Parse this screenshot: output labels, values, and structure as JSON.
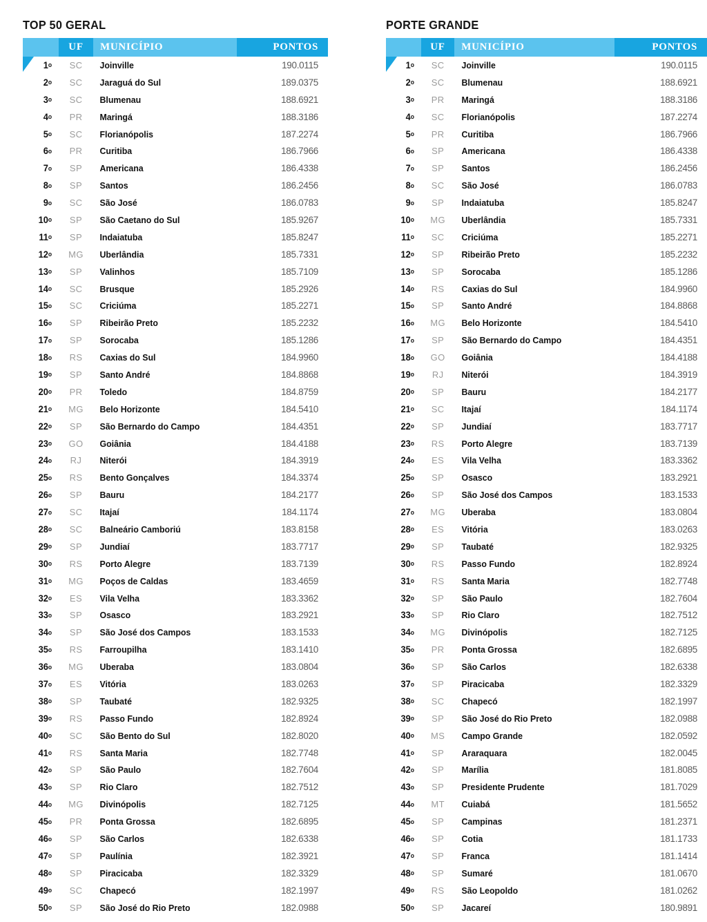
{
  "colors": {
    "header_light_blue": "#5bc3ee",
    "header_blue": "#18a5e0",
    "rank_text": "#111111",
    "uf_text": "#9b9b9b",
    "municipio_text": "#111111",
    "pontos_text": "#5a5a5a"
  },
  "columns": {
    "rank": "",
    "uf": "UF",
    "municipio": "MUNICÍPIO",
    "pontos": "PONTOS"
  },
  "tables": [
    {
      "title": "TOP 50 GERAL",
      "rows": [
        {
          "rank": "1",
          "uf": "SC",
          "municipio": "Joinville",
          "pontos": "190.0115"
        },
        {
          "rank": "2",
          "uf": "SC",
          "municipio": "Jaraguá do Sul",
          "pontos": "189.0375"
        },
        {
          "rank": "3",
          "uf": "SC",
          "municipio": "Blumenau",
          "pontos": "188.6921"
        },
        {
          "rank": "4",
          "uf": "PR",
          "municipio": "Maringá",
          "pontos": "188.3186"
        },
        {
          "rank": "5",
          "uf": "SC",
          "municipio": "Florianópolis",
          "pontos": "187.2274"
        },
        {
          "rank": "6",
          "uf": "PR",
          "municipio": "Curitiba",
          "pontos": "186.7966"
        },
        {
          "rank": "7",
          "uf": "SP",
          "municipio": "Americana",
          "pontos": "186.4338"
        },
        {
          "rank": "8",
          "uf": "SP",
          "municipio": "Santos",
          "pontos": "186.2456"
        },
        {
          "rank": "9",
          "uf": "SC",
          "municipio": "São José",
          "pontos": "186.0783"
        },
        {
          "rank": "10",
          "uf": "SP",
          "municipio": "São Caetano do Sul",
          "pontos": "185.9267"
        },
        {
          "rank": "11",
          "uf": "SP",
          "municipio": "Indaiatuba",
          "pontos": "185.8247"
        },
        {
          "rank": "12",
          "uf": "MG",
          "municipio": "Uberlândia",
          "pontos": "185.7331"
        },
        {
          "rank": "13",
          "uf": "SP",
          "municipio": "Valinhos",
          "pontos": "185.7109"
        },
        {
          "rank": "14",
          "uf": "SC",
          "municipio": "Brusque",
          "pontos": "185.2926"
        },
        {
          "rank": "15",
          "uf": "SC",
          "municipio": "Criciúma",
          "pontos": "185.2271"
        },
        {
          "rank": "16",
          "uf": "SP",
          "municipio": "Ribeirão Preto",
          "pontos": "185.2232"
        },
        {
          "rank": "17",
          "uf": "SP",
          "municipio": "Sorocaba",
          "pontos": "185.1286"
        },
        {
          "rank": "18",
          "uf": "RS",
          "municipio": "Caxias do Sul",
          "pontos": "184.9960"
        },
        {
          "rank": "19",
          "uf": "SP",
          "municipio": "Santo André",
          "pontos": "184.8868"
        },
        {
          "rank": "20",
          "uf": "PR",
          "municipio": "Toledo",
          "pontos": "184.8759"
        },
        {
          "rank": "21",
          "uf": "MG",
          "municipio": "Belo Horizonte",
          "pontos": "184.5410"
        },
        {
          "rank": "22",
          "uf": "SP",
          "municipio": "São Bernardo do Campo",
          "pontos": "184.4351"
        },
        {
          "rank": "23",
          "uf": "GO",
          "municipio": "Goiânia",
          "pontos": "184.4188"
        },
        {
          "rank": "24",
          "uf": "RJ",
          "municipio": "Niterói",
          "pontos": "184.3919"
        },
        {
          "rank": "25",
          "uf": "RS",
          "municipio": "Bento Gonçalves",
          "pontos": "184.3374"
        },
        {
          "rank": "26",
          "uf": "SP",
          "municipio": "Bauru",
          "pontos": "184.2177"
        },
        {
          "rank": "27",
          "uf": "SC",
          "municipio": "Itajaí",
          "pontos": "184.1174"
        },
        {
          "rank": "28",
          "uf": "SC",
          "municipio": "Balneário Camboriú",
          "pontos": "183.8158"
        },
        {
          "rank": "29",
          "uf": "SP",
          "municipio": "Jundiaí",
          "pontos": "183.7717"
        },
        {
          "rank": "30",
          "uf": "RS",
          "municipio": "Porto Alegre",
          "pontos": "183.7139"
        },
        {
          "rank": "31",
          "uf": "MG",
          "municipio": "Poços de Caldas",
          "pontos": "183.4659"
        },
        {
          "rank": "32",
          "uf": "ES",
          "municipio": "Vila Velha",
          "pontos": "183.3362"
        },
        {
          "rank": "33",
          "uf": "SP",
          "municipio": "Osasco",
          "pontos": "183.2921"
        },
        {
          "rank": "34",
          "uf": "SP",
          "municipio": "São José dos Campos",
          "pontos": "183.1533"
        },
        {
          "rank": "35",
          "uf": "RS",
          "municipio": "Farroupilha",
          "pontos": "183.1410"
        },
        {
          "rank": "36",
          "uf": "MG",
          "municipio": "Uberaba",
          "pontos": "183.0804"
        },
        {
          "rank": "37",
          "uf": "ES",
          "municipio": "Vitória",
          "pontos": "183.0263"
        },
        {
          "rank": "38",
          "uf": "SP",
          "municipio": "Taubaté",
          "pontos": "182.9325"
        },
        {
          "rank": "39",
          "uf": "RS",
          "municipio": "Passo Fundo",
          "pontos": "182.8924"
        },
        {
          "rank": "40",
          "uf": "SC",
          "municipio": "São Bento do Sul",
          "pontos": "182.8020"
        },
        {
          "rank": "41",
          "uf": "RS",
          "municipio": "Santa Maria",
          "pontos": "182.7748"
        },
        {
          "rank": "42",
          "uf": "SP",
          "municipio": "São Paulo",
          "pontos": "182.7604"
        },
        {
          "rank": "43",
          "uf": "SP",
          "municipio": "Rio Claro",
          "pontos": "182.7512"
        },
        {
          "rank": "44",
          "uf": "MG",
          "municipio": "Divinópolis",
          "pontos": "182.7125"
        },
        {
          "rank": "45",
          "uf": "PR",
          "municipio": "Ponta Grossa",
          "pontos": "182.6895"
        },
        {
          "rank": "46",
          "uf": "SP",
          "municipio": "São Carlos",
          "pontos": "182.6338"
        },
        {
          "rank": "47",
          "uf": "SP",
          "municipio": "Paulínia",
          "pontos": "182.3921"
        },
        {
          "rank": "48",
          "uf": "SP",
          "municipio": "Piracicaba",
          "pontos": "182.3329"
        },
        {
          "rank": "49",
          "uf": "SC",
          "municipio": "Chapecó",
          "pontos": "182.1997"
        },
        {
          "rank": "50",
          "uf": "SP",
          "municipio": "São José do Rio Preto",
          "pontos": "182.0988"
        }
      ]
    },
    {
      "title": "PORTE GRANDE",
      "rows": [
        {
          "rank": "1",
          "uf": "SC",
          "municipio": "Joinville",
          "pontos": "190.0115"
        },
        {
          "rank": "2",
          "uf": "SC",
          "municipio": "Blumenau",
          "pontos": "188.6921"
        },
        {
          "rank": "3",
          "uf": "PR",
          "municipio": "Maringá",
          "pontos": "188.3186"
        },
        {
          "rank": "4",
          "uf": "SC",
          "municipio": "Florianópolis",
          "pontos": "187.2274"
        },
        {
          "rank": "5",
          "uf": "PR",
          "municipio": "Curitiba",
          "pontos": "186.7966"
        },
        {
          "rank": "6",
          "uf": "SP",
          "municipio": "Americana",
          "pontos": "186.4338"
        },
        {
          "rank": "7",
          "uf": "SP",
          "municipio": "Santos",
          "pontos": "186.2456"
        },
        {
          "rank": "8",
          "uf": "SC",
          "municipio": "São José",
          "pontos": "186.0783"
        },
        {
          "rank": "9",
          "uf": "SP",
          "municipio": "Indaiatuba",
          "pontos": "185.8247"
        },
        {
          "rank": "10",
          "uf": "MG",
          "municipio": "Uberlândia",
          "pontos": "185.7331"
        },
        {
          "rank": "11",
          "uf": "SC",
          "municipio": "Criciúma",
          "pontos": "185.2271"
        },
        {
          "rank": "12",
          "uf": "SP",
          "municipio": "Ribeirão Preto",
          "pontos": "185.2232"
        },
        {
          "rank": "13",
          "uf": "SP",
          "municipio": "Sorocaba",
          "pontos": "185.1286"
        },
        {
          "rank": "14",
          "uf": "RS",
          "municipio": "Caxias do Sul",
          "pontos": "184.9960"
        },
        {
          "rank": "15",
          "uf": "SP",
          "municipio": "Santo André",
          "pontos": "184.8868"
        },
        {
          "rank": "16",
          "uf": "MG",
          "municipio": "Belo Horizonte",
          "pontos": "184.5410"
        },
        {
          "rank": "17",
          "uf": "SP",
          "municipio": "São Bernardo do Campo",
          "pontos": "184.4351"
        },
        {
          "rank": "18",
          "uf": "GO",
          "municipio": "Goiânia",
          "pontos": "184.4188"
        },
        {
          "rank": "19",
          "uf": "RJ",
          "municipio": "Niterói",
          "pontos": "184.3919"
        },
        {
          "rank": "20",
          "uf": "SP",
          "municipio": "Bauru",
          "pontos": "184.2177"
        },
        {
          "rank": "21",
          "uf": "SC",
          "municipio": "Itajaí",
          "pontos": "184.1174"
        },
        {
          "rank": "22",
          "uf": "SP",
          "municipio": "Jundiaí",
          "pontos": "183.7717"
        },
        {
          "rank": "23",
          "uf": "RS",
          "municipio": "Porto Alegre",
          "pontos": "183.7139"
        },
        {
          "rank": "24",
          "uf": "ES",
          "municipio": "Vila Velha",
          "pontos": "183.3362"
        },
        {
          "rank": "25",
          "uf": "SP",
          "municipio": "Osasco",
          "pontos": "183.2921"
        },
        {
          "rank": "26",
          "uf": "SP",
          "municipio": "São José dos Campos",
          "pontos": "183.1533"
        },
        {
          "rank": "27",
          "uf": "MG",
          "municipio": "Uberaba",
          "pontos": "183.0804"
        },
        {
          "rank": "28",
          "uf": "ES",
          "municipio": "Vitória",
          "pontos": "183.0263"
        },
        {
          "rank": "29",
          "uf": "SP",
          "municipio": "Taubaté",
          "pontos": "182.9325"
        },
        {
          "rank": "30",
          "uf": "RS",
          "municipio": "Passo Fundo",
          "pontos": "182.8924"
        },
        {
          "rank": "31",
          "uf": "RS",
          "municipio": "Santa Maria",
          "pontos": "182.7748"
        },
        {
          "rank": "32",
          "uf": "SP",
          "municipio": "São Paulo",
          "pontos": "182.7604"
        },
        {
          "rank": "33",
          "uf": "SP",
          "municipio": "Rio Claro",
          "pontos": "182.7512"
        },
        {
          "rank": "34",
          "uf": "MG",
          "municipio": "Divinópolis",
          "pontos": "182.7125"
        },
        {
          "rank": "35",
          "uf": "PR",
          "municipio": "Ponta Grossa",
          "pontos": "182.6895"
        },
        {
          "rank": "36",
          "uf": "SP",
          "municipio": "São Carlos",
          "pontos": "182.6338"
        },
        {
          "rank": "37",
          "uf": "SP",
          "municipio": "Piracicaba",
          "pontos": "182.3329"
        },
        {
          "rank": "38",
          "uf": "SC",
          "municipio": "Chapecó",
          "pontos": "182.1997"
        },
        {
          "rank": "39",
          "uf": "SP",
          "municipio": "São José do Rio Preto",
          "pontos": "182.0988"
        },
        {
          "rank": "40",
          "uf": "MS",
          "municipio": "Campo Grande",
          "pontos": "182.0592"
        },
        {
          "rank": "41",
          "uf": "SP",
          "municipio": "Araraquara",
          "pontos": "182.0045"
        },
        {
          "rank": "42",
          "uf": "SP",
          "municipio": "Marília",
          "pontos": "181.8085"
        },
        {
          "rank": "43",
          "uf": "SP",
          "municipio": "Presidente Prudente",
          "pontos": "181.7029"
        },
        {
          "rank": "44",
          "uf": "MT",
          "municipio": "Cuiabá",
          "pontos": "181.5652"
        },
        {
          "rank": "45",
          "uf": "SP",
          "municipio": "Campinas",
          "pontos": "181.2371"
        },
        {
          "rank": "46",
          "uf": "SP",
          "municipio": "Cotia",
          "pontos": "181.1733"
        },
        {
          "rank": "47",
          "uf": "SP",
          "municipio": "Franca",
          "pontos": "181.1414"
        },
        {
          "rank": "48",
          "uf": "SP",
          "municipio": "Sumaré",
          "pontos": "181.0670"
        },
        {
          "rank": "49",
          "uf": "RS",
          "municipio": "São Leopoldo",
          "pontos": "181.0262"
        },
        {
          "rank": "50",
          "uf": "SP",
          "municipio": "Jacareí",
          "pontos": "180.9891"
        }
      ]
    }
  ]
}
